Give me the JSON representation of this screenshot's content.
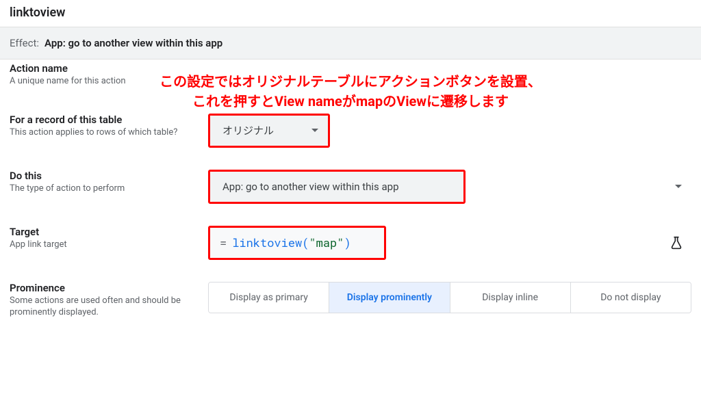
{
  "page": {
    "title": "linktoview"
  },
  "effect": {
    "label": "Effect:",
    "value": "App: go to another view within this app"
  },
  "annotation": {
    "line1": "この設定ではオリジナルテーブルにアクションボタンを設置、",
    "line2": "これを押すとView nameがmapのViewに遷移します"
  },
  "sections": {
    "action_name": {
      "title": "Action name",
      "desc": "A unique name for this action"
    },
    "record_table": {
      "title": "For a record of this table",
      "desc": "This action applies to rows of which table?",
      "value": "オリジナル"
    },
    "do_this": {
      "title": "Do this",
      "desc": "The type of action to perform",
      "value": "App: go to another view within this app"
    },
    "target": {
      "title": "Target",
      "desc": "App link target",
      "formula": {
        "fn": "linktoview",
        "arg": "\"map\""
      }
    },
    "prominence": {
      "title": "Prominence",
      "desc": "Some actions are used often and should be prominently displayed.",
      "options": [
        {
          "label": "Display as primary",
          "selected": false
        },
        {
          "label": "Display prominently",
          "selected": true
        },
        {
          "label": "Display inline",
          "selected": false
        },
        {
          "label": "Do not display",
          "selected": false
        }
      ]
    }
  }
}
